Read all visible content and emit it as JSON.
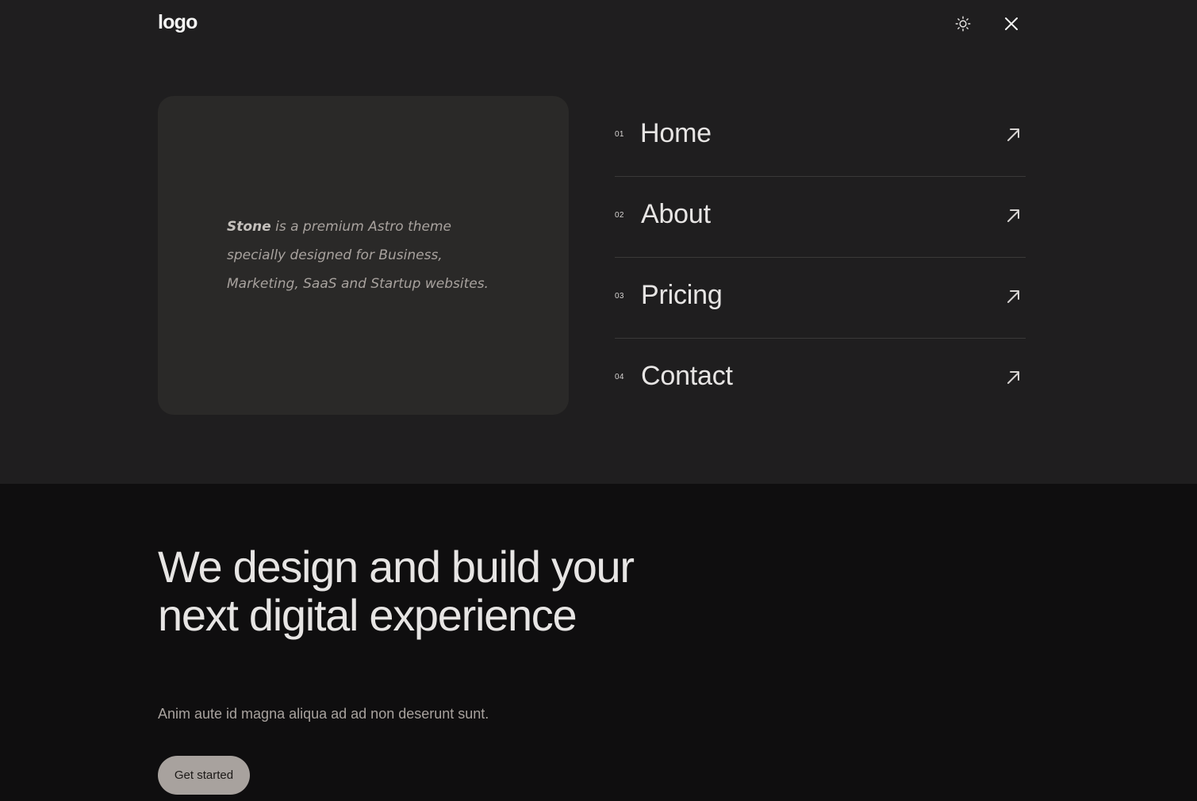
{
  "header": {
    "logo": "logo",
    "theme_icon": "sun-icon",
    "close_icon": "close-icon"
  },
  "about_card": {
    "brand": "Stone",
    "text": " is a premium Astro theme specially designed for Business, Marketing, SaaS and Startup websites."
  },
  "nav": {
    "items": [
      {
        "num": "01",
        "label": "Home",
        "icon": "arrow-up-right-icon"
      },
      {
        "num": "02",
        "label": "About",
        "icon": "arrow-up-right-icon"
      },
      {
        "num": "03",
        "label": "Pricing",
        "icon": "arrow-up-right-icon"
      },
      {
        "num": "04",
        "label": "Contact",
        "icon": "arrow-up-right-icon"
      }
    ]
  },
  "hero": {
    "title": "We design and build your next digital experience",
    "subtitle": "Anim aute id magna aliqua ad ad non deserunt sunt.",
    "cta_label": "Get started"
  },
  "colors": {
    "menu_background": "#1f1e1f",
    "page_background": "#0f0e0f",
    "card_background": "#2a2928",
    "button_background": "#a8a29e"
  }
}
